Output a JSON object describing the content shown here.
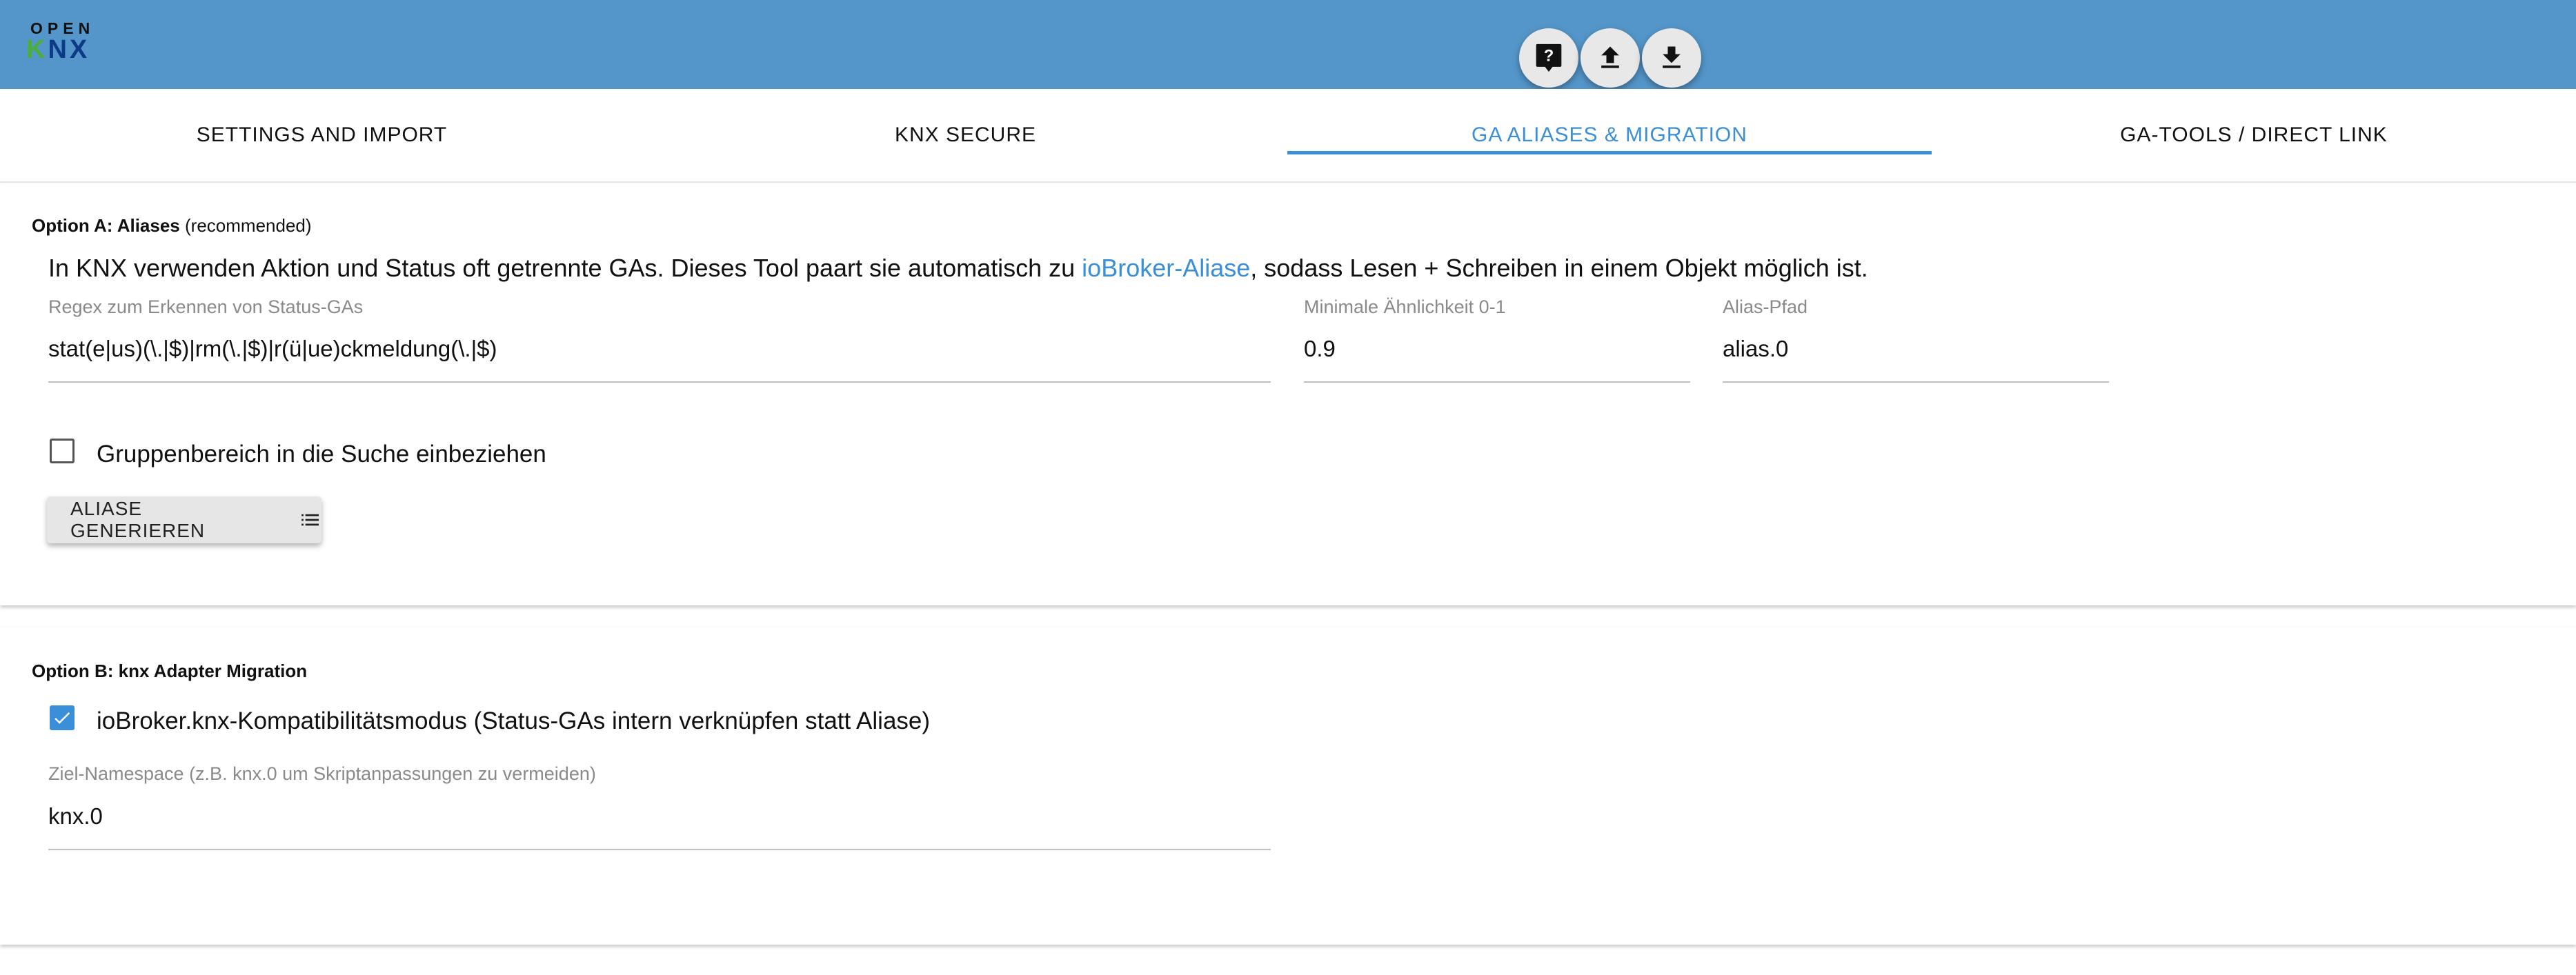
{
  "header": {
    "logo_top": "OPEN",
    "logo_k": "K",
    "logo_n": "N",
    "logo_x": "X",
    "buttons": [
      {
        "name": "help-icon"
      },
      {
        "name": "upload-icon"
      },
      {
        "name": "download-icon"
      }
    ]
  },
  "tabs": [
    {
      "label": "SETTINGS AND IMPORT",
      "active": false
    },
    {
      "label": "KNX SECURE",
      "active": false
    },
    {
      "label": "GA ALIASES & MIGRATION",
      "active": true
    },
    {
      "label": "GA-TOOLS / DIRECT LINK",
      "active": false
    }
  ],
  "option_a": {
    "heading": "Option A: Aliases",
    "heading_note": "(recommended)",
    "description_before": "In KNX verwenden Aktion und Status oft getrennte GAs. Dieses Tool paart sie automatisch zu ",
    "description_link": "ioBroker-Aliase",
    "description_after": ", sodass Lesen + Schreiben in einem Objekt möglich ist.",
    "regex_label": "Regex zum Erkennen von Status-GAs",
    "regex_value": "stat(e|us)(\\.|$)|rm(\\.|$)|r(ü|ue)ckmeldung(\\.|$)",
    "similarity_label": "Minimale Ähnlichkeit 0-1",
    "similarity_value": "0.9",
    "alias_path_label": "Alias-Pfad",
    "alias_path_value": "alias.0",
    "checkbox_label": "Gruppenbereich in die Suche einbeziehen",
    "checkbox_checked": false,
    "button_label": "ALIASE GENERIEREN"
  },
  "option_b": {
    "heading": "Option B: knx Adapter Migration",
    "checkbox_label": "ioBroker.knx-Kompatibilitätsmodus (Status-GAs intern verknüpfen statt Aliase)",
    "checkbox_checked": true,
    "namespace_label": "Ziel-Namespace (z.B. knx.0 um Skriptanpassungen zu vermeiden)",
    "namespace_value": "knx.0"
  },
  "colors": {
    "appbar": "#5496c9",
    "accent": "#3a8fd8",
    "logo_green": "#4cae3a",
    "logo_blue": "#0c3a86"
  }
}
